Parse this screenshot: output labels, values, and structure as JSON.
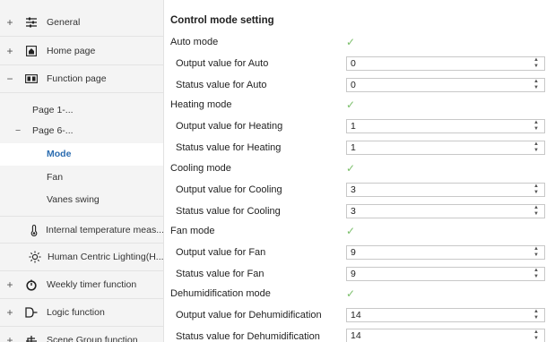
{
  "sidebar": {
    "items": [
      {
        "expander": "+",
        "icon": "general-settings-icon",
        "label": "General"
      },
      {
        "expander": "+",
        "icon": "home-icon",
        "label": "Home page"
      },
      {
        "expander": "−",
        "icon": "function-page-icon",
        "label": "Function page"
      }
    ],
    "function_pages": [
      {
        "expander": "",
        "label": "Page 1-..."
      },
      {
        "expander": "−",
        "label": "Page 6-..."
      }
    ],
    "page6_children": [
      {
        "label": "Mode",
        "active": true
      },
      {
        "label": "Fan",
        "active": false
      },
      {
        "label": "Vanes swing",
        "active": false
      }
    ],
    "lower_items": [
      {
        "expander": "",
        "icon": "thermometer-icon",
        "label": "Internal temperature meas..."
      },
      {
        "expander": "",
        "icon": "sun-icon",
        "label": "Human Centric Lighting(H..."
      },
      {
        "expander": "+",
        "icon": "timer-icon",
        "label": "Weekly timer function"
      },
      {
        "expander": "+",
        "icon": "logic-icon",
        "label": "Logic function"
      },
      {
        "expander": "+",
        "icon": "scene-group-icon",
        "label": "Scene Group function"
      }
    ]
  },
  "main": {
    "section_title": "Control mode setting",
    "rows": [
      {
        "label": "Auto mode",
        "type": "check",
        "checked": true
      },
      {
        "label": "Output value for Auto",
        "type": "spin",
        "value": "0"
      },
      {
        "label": "Status value for Auto",
        "type": "spin",
        "value": "0"
      },
      {
        "label": "Heating mode",
        "type": "check",
        "checked": true
      },
      {
        "label": "Output value for Heating",
        "type": "spin",
        "value": "1"
      },
      {
        "label": "Status value for Heating",
        "type": "spin",
        "value": "1"
      },
      {
        "label": "Cooling mode",
        "type": "check",
        "checked": true
      },
      {
        "label": "Output value for Cooling",
        "type": "spin",
        "value": "3"
      },
      {
        "label": "Status value for Cooling",
        "type": "spin",
        "value": "3"
      },
      {
        "label": "Fan mode",
        "type": "check",
        "checked": true
      },
      {
        "label": "Output value for Fan",
        "type": "spin",
        "value": "9"
      },
      {
        "label": "Status value for Fan",
        "type": "spin",
        "value": "9"
      },
      {
        "label": "Dehumidification mode",
        "type": "check",
        "checked": true
      },
      {
        "label": "Output value for Dehumidification",
        "type": "spin",
        "value": "14"
      },
      {
        "label": "Status value for Dehumidification",
        "type": "spin",
        "value": "14"
      }
    ]
  },
  "colors": {
    "accent": "#2b6cb0",
    "check": "#7bbf6a",
    "sidebar_bg": "#f4f4f4"
  }
}
